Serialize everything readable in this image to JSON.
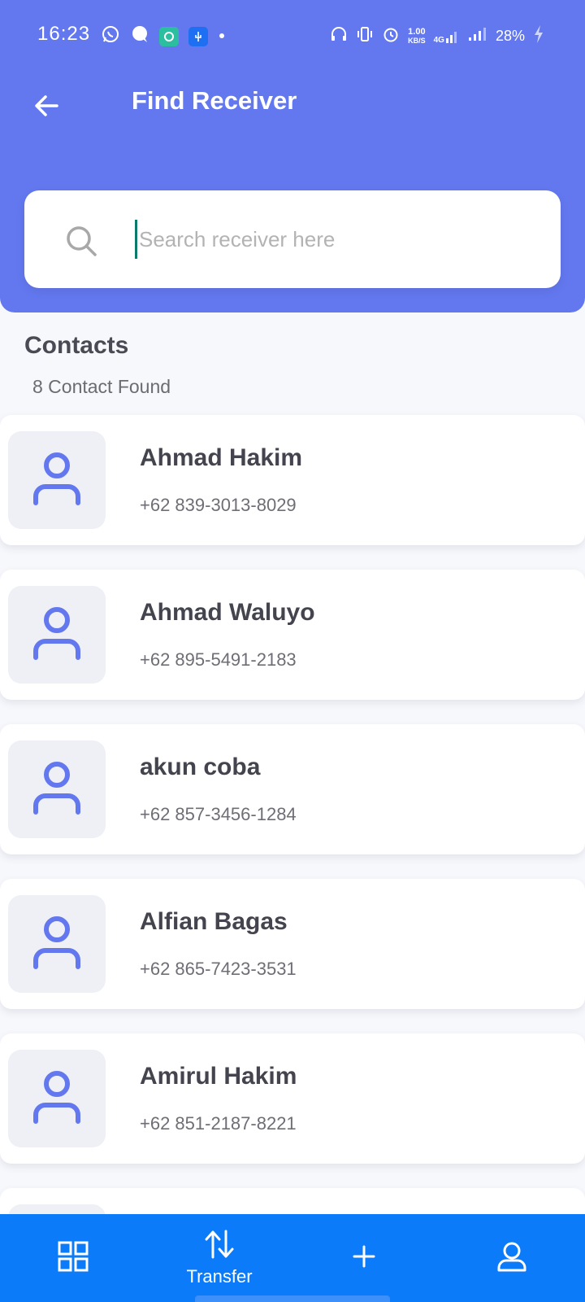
{
  "status_bar": {
    "time": "16:23",
    "net_speed_value": "1.00",
    "net_speed_unit": "KB/S",
    "network_type": "4G",
    "battery": "28%"
  },
  "header": {
    "title": "Find Receiver"
  },
  "search": {
    "placeholder": "Search receiver here",
    "value": ""
  },
  "contacts_section": {
    "title": "Contacts",
    "count_text": "8 Contact Found"
  },
  "contacts": [
    {
      "name": "Ahmad Hakim",
      "phone": "+62 839-3013-8029"
    },
    {
      "name": "Ahmad Waluyo",
      "phone": "+62 895-5491-2183"
    },
    {
      "name": "akun coba",
      "phone": "+62 857-3456-1284"
    },
    {
      "name": "Alfian Bagas",
      "phone": "+62 865-7423-3531"
    },
    {
      "name": "Amirul Hakim",
      "phone": "+62 851-2187-8221"
    }
  ],
  "bottom_nav": {
    "items": [
      {
        "icon": "grid-icon",
        "label": ""
      },
      {
        "icon": "transfer-icon",
        "label": "Transfer"
      },
      {
        "icon": "plus-icon",
        "label": ""
      },
      {
        "icon": "profile-icon",
        "label": ""
      }
    ]
  },
  "colors": {
    "header_bg": "#6378ef",
    "nav_bg": "#0b7bf9",
    "avatar_icon": "#6378ef",
    "page_bg": "#f7f8fc"
  }
}
